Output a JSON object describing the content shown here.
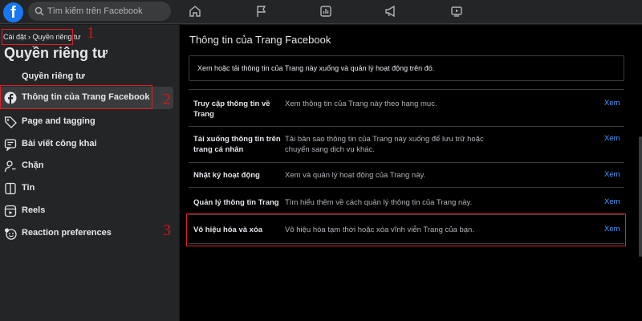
{
  "header": {
    "logo_letter": "f",
    "search_placeholder": "Tìm kiếm trên Facebook",
    "nav_icons": [
      "home-icon",
      "flag-icon",
      "insights-icon",
      "megaphone-icon",
      "video-icon"
    ]
  },
  "sidebar": {
    "breadcrumb": "Cài đặt › Quyền riêng tư",
    "title": "Quyền riêng tư",
    "items": [
      {
        "label": "Quyền riêng tư",
        "icon": "none"
      },
      {
        "label": "Thông tin của Trang Facebook",
        "icon": "facebook-icon"
      },
      {
        "label": "Page and tagging",
        "icon": "tag-icon"
      },
      {
        "label": "Bài viết công khai",
        "icon": "public-posts-icon"
      },
      {
        "label": "Chặn",
        "icon": "block-user-icon"
      },
      {
        "label": "Tin",
        "icon": "story-icon"
      },
      {
        "label": "Reels",
        "icon": "reels-icon"
      },
      {
        "label": "Reaction preferences",
        "icon": "reaction-icon"
      }
    ]
  },
  "annotations": {
    "n1": "1",
    "n2": "2",
    "n3": "3"
  },
  "main": {
    "title": "Thông tin của Trang Facebook",
    "description": "Xem hoặc tải thông tin của Trang này xuống và quản lý hoạt động trên đó.",
    "rows": [
      {
        "title": "Truy cập thông tin về Trang",
        "desc": "Xem thông tin của Trang này theo hạng mục.",
        "link": "Xem"
      },
      {
        "title": "Tải xuống thông tin trên trang cá nhân",
        "desc": "Tải bản sao thông tin của Trang này xuống để lưu trữ hoặc chuyển sang dịch vụ khác.",
        "link": "Xem"
      },
      {
        "title": "Nhật ký hoạt động",
        "desc": "Xem và quản lý hoạt động của Trang này.",
        "link": "Xem"
      },
      {
        "title": "Quản lý thông tin Trang",
        "desc": "Tìm hiểu thêm về cách quản lý thông tin của Trang này.",
        "link": "Xem"
      },
      {
        "title": "Vô hiệu hóa và xóa",
        "desc": "Vô hiệu hóa tạm thời hoặc xóa vĩnh viễn Trang của bạn.",
        "link": "Xem"
      }
    ]
  },
  "colors": {
    "accent": "#1877f2",
    "highlight": "#e0202a",
    "link": "#4599ff"
  }
}
